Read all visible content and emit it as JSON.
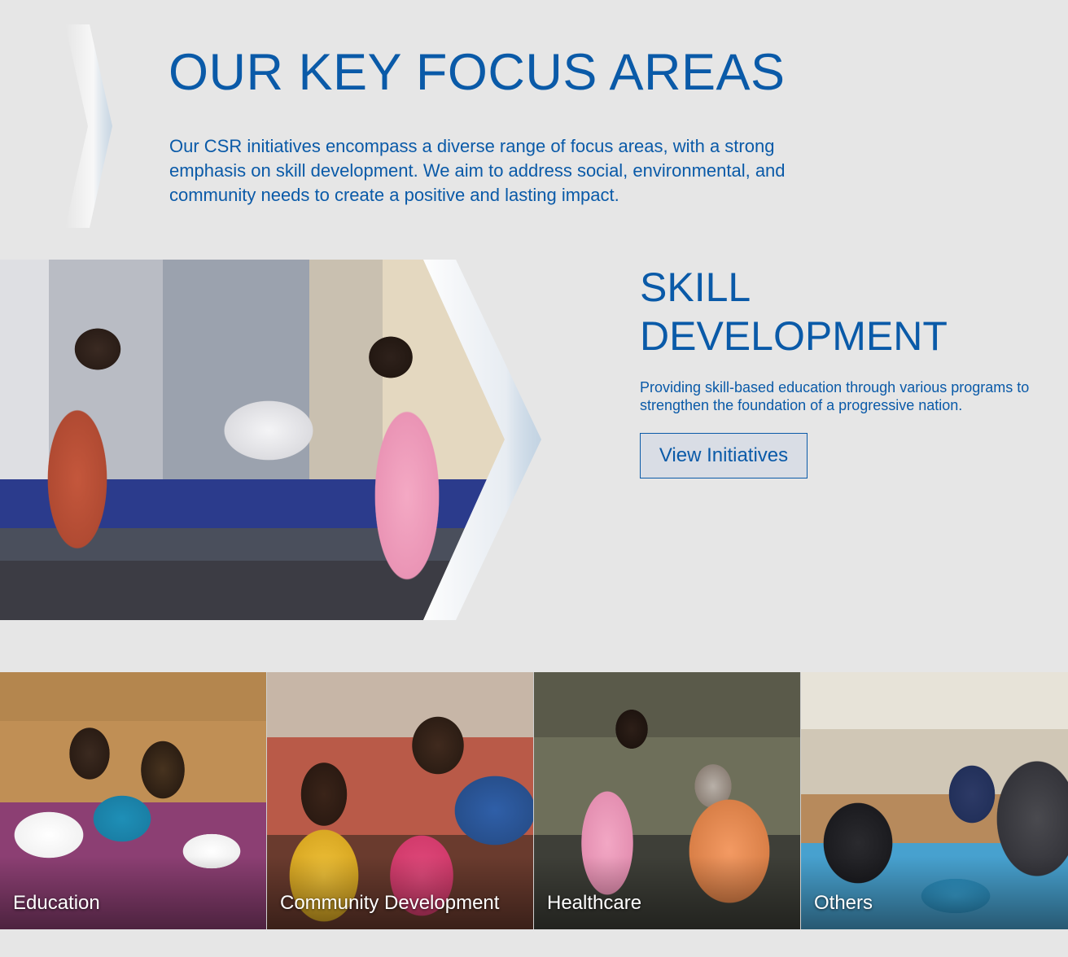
{
  "page": {
    "title": "OUR KEY FOCUS AREAS",
    "intro": "Our CSR initiatives encompass a diverse range of focus areas, with a strong emphasis on skill development. We aim to address social, environmental, and community needs to create a positive and lasting impact."
  },
  "feature": {
    "title": "SKILL\nDEVELOPMENT",
    "description": "Providing skill-based education through various programs to strengthen the foundation of a progressive nation.",
    "button_label": "View Initiatives"
  },
  "focus_areas": [
    {
      "label": "Education"
    },
    {
      "label": "Community Development"
    },
    {
      "label": "Healthcare"
    },
    {
      "label": "Others"
    }
  ],
  "colors": {
    "brand_blue": "#0a5aa8",
    "background": "#e6e6e6"
  }
}
